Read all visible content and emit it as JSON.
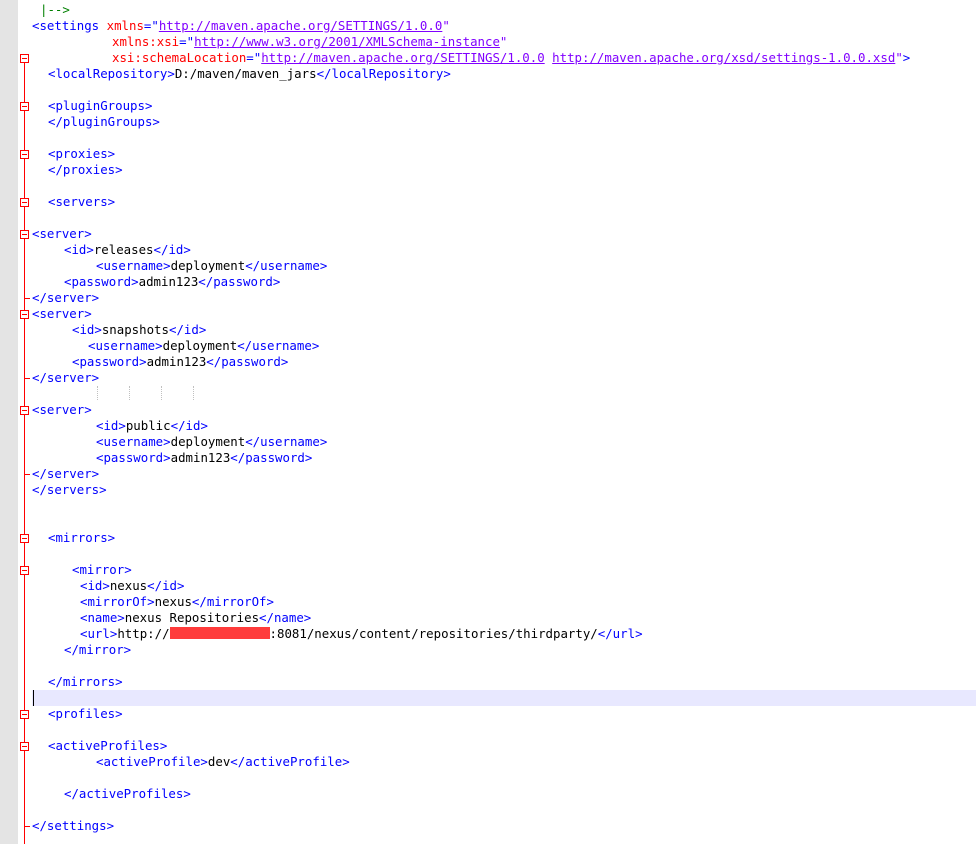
{
  "lines": [
    {
      "segs": [
        [
          "c",
          "|-->"
        ]
      ]
    },
    {
      "segs": [
        [
          "t",
          "<settings "
        ],
        [
          "a",
          "xmlns"
        ],
        [
          "t",
          "=\""
        ],
        [
          "v",
          "http://maven.apache.org/SETTINGS/1.0.0"
        ],
        [
          "q",
          "\""
        ]
      ]
    },
    {
      "segs": [
        [
          "a",
          "xmlns:xsi"
        ],
        [
          "t",
          "=\""
        ],
        [
          "v",
          "http://www.w3.org/2001/XMLSchema-instance"
        ],
        [
          "q",
          "\""
        ]
      ]
    },
    {
      "segs": [
        [
          "a",
          "xsi:schemaLocation"
        ],
        [
          "t",
          "=\""
        ],
        [
          "v",
          "http://maven.apache.org/SETTINGS/1.0.0"
        ],
        [
          "tx",
          " "
        ],
        [
          "v",
          "http://maven.apache.org/xsd/settings-1.0.0.xsd"
        ],
        [
          "q",
          "\""
        ],
        [
          "t",
          ">"
        ]
      ]
    },
    {
      "segs": [
        [
          "t",
          "<localRepository>"
        ],
        [
          "tx",
          "D:/maven/maven_jars"
        ],
        [
          "t",
          "</localRepository>"
        ]
      ]
    },
    {
      "segs": []
    },
    {
      "segs": [
        [
          "t",
          "<pluginGroups>"
        ]
      ]
    },
    {
      "segs": [
        [
          "t",
          "</pluginGroups>"
        ]
      ]
    },
    {
      "segs": []
    },
    {
      "segs": [
        [
          "t",
          "<proxies>"
        ]
      ]
    },
    {
      "segs": [
        [
          "t",
          "</proxies>"
        ]
      ]
    },
    {
      "segs": []
    },
    {
      "segs": [
        [
          "t",
          "<servers>"
        ]
      ]
    },
    {
      "segs": []
    },
    {
      "segs": [
        [
          "t",
          "<server>"
        ]
      ]
    },
    {
      "segs": [
        [
          "t",
          "<id>"
        ],
        [
          "tx",
          "releases"
        ],
        [
          "t",
          "</id>"
        ]
      ]
    },
    {
      "segs": [
        [
          "t",
          "<username>"
        ],
        [
          "tx",
          "deployment"
        ],
        [
          "t",
          "</username>"
        ]
      ]
    },
    {
      "segs": [
        [
          "t",
          "<password>"
        ],
        [
          "tx",
          "admin123"
        ],
        [
          "t",
          "</password>"
        ]
      ]
    },
    {
      "segs": [
        [
          "t",
          "</server>"
        ]
      ]
    },
    {
      "segs": [
        [
          "t",
          "<server>"
        ]
      ]
    },
    {
      "segs": [
        [
          "t",
          "<id>"
        ],
        [
          "tx",
          "snapshots"
        ],
        [
          "t",
          "</id>"
        ]
      ]
    },
    {
      "segs": [
        [
          "t",
          "<username>"
        ],
        [
          "tx",
          "deployment"
        ],
        [
          "t",
          "</username>"
        ]
      ]
    },
    {
      "segs": [
        [
          "t",
          "<password>"
        ],
        [
          "tx",
          "admin123"
        ],
        [
          "t",
          "</password>"
        ]
      ]
    },
    {
      "segs": [
        [
          "t",
          "</server>"
        ]
      ]
    },
    {
      "segs": []
    },
    {
      "segs": [
        [
          "t",
          "<server>"
        ]
      ]
    },
    {
      "segs": [
        [
          "t",
          "<id>"
        ],
        [
          "tx",
          "public"
        ],
        [
          "t",
          "</id>"
        ]
      ]
    },
    {
      "segs": [
        [
          "t",
          "<username>"
        ],
        [
          "tx",
          "deployment"
        ],
        [
          "t",
          "</username>"
        ]
      ]
    },
    {
      "segs": [
        [
          "t",
          "<password>"
        ],
        [
          "tx",
          "admin123"
        ],
        [
          "t",
          "</password>"
        ]
      ]
    },
    {
      "segs": [
        [
          "t",
          "</server>"
        ]
      ]
    },
    {
      "segs": [
        [
          "t",
          "</servers>"
        ]
      ]
    },
    {
      "segs": []
    },
    {
      "segs": []
    },
    {
      "segs": [
        [
          "t",
          "<mirrors>"
        ]
      ]
    },
    {
      "segs": []
    },
    {
      "segs": [
        [
          "t",
          "<mirror>"
        ]
      ]
    },
    {
      "segs": [
        [
          "t",
          "<id>"
        ],
        [
          "tx",
          "nexus"
        ],
        [
          "t",
          "</id>"
        ]
      ]
    },
    {
      "segs": [
        [
          "t",
          "<mirrorOf>"
        ],
        [
          "tx",
          "nexus"
        ],
        [
          "t",
          "</mirrorOf>"
        ]
      ]
    },
    {
      "segs": [
        [
          "t",
          "<name>"
        ],
        [
          "tx",
          "nexus Repositories"
        ],
        [
          "t",
          "</name>"
        ]
      ]
    },
    {
      "segs": [
        [
          "t",
          "<url>"
        ],
        [
          "tx",
          "http://"
        ],
        [
          "redact",
          ""
        ],
        [
          "tx",
          ":8081/nexus/content/repositories/thirdparty/"
        ],
        [
          "t",
          "</url>"
        ]
      ]
    },
    {
      "segs": [
        [
          "t",
          "</mirror>"
        ]
      ]
    },
    {
      "segs": []
    },
    {
      "segs": [
        [
          "t",
          "</mirrors>"
        ]
      ]
    },
    {
      "segs": []
    },
    {
      "segs": [
        [
          "t",
          "<profiles>"
        ]
      ]
    },
    {
      "segs": []
    },
    {
      "segs": [
        [
          "t",
          "<activeProfiles>"
        ]
      ]
    },
    {
      "segs": [
        [
          "t",
          "<activeProfile>"
        ],
        [
          "tx",
          "dev"
        ],
        [
          "t",
          "</activeProfile>"
        ]
      ]
    },
    {
      "segs": []
    },
    {
      "segs": [
        [
          "t",
          "</activeProfiles>"
        ]
      ]
    },
    {
      "segs": []
    },
    {
      "segs": [
        [
          "t",
          "</settings>"
        ]
      ]
    }
  ]
}
